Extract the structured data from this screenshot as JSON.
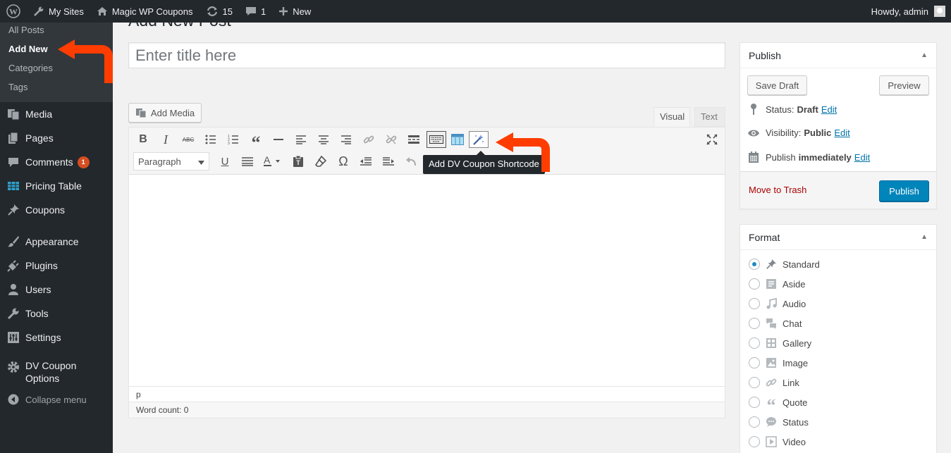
{
  "adminbar": {
    "my_sites": "My Sites",
    "site_name": "Magic WP Coupons",
    "updates": "15",
    "comments": "1",
    "new": "New",
    "howdy": "Howdy, admin"
  },
  "sidebar": {
    "submenu": [
      "All Posts",
      "Add New",
      "Categories",
      "Tags"
    ],
    "items": [
      {
        "label": "Media",
        "icon": "media-icon"
      },
      {
        "label": "Pages",
        "icon": "pages-icon"
      },
      {
        "label": "Comments",
        "icon": "comments-icon",
        "badge": "1"
      },
      {
        "label": "Pricing Table",
        "icon": "table-icon"
      },
      {
        "label": "Coupons",
        "icon": "pin-icon"
      },
      {
        "label": "Appearance",
        "icon": "brush-icon"
      },
      {
        "label": "Plugins",
        "icon": "plug-icon"
      },
      {
        "label": "Users",
        "icon": "users-icon"
      },
      {
        "label": "Tools",
        "icon": "wrench-icon"
      },
      {
        "label": "Settings",
        "icon": "settings-icon"
      },
      {
        "label_line1": "DV Coupon",
        "label_line2": "Options",
        "icon": "gear-icon"
      }
    ],
    "collapse": "Collapse menu"
  },
  "main": {
    "page_title": "Add New Post",
    "title_placeholder": "Enter title here",
    "add_media": "Add Media",
    "tab_visual": "Visual",
    "tab_text": "Text",
    "format_select": "Paragraph",
    "tooltip": "Add DV Coupon Shortcode",
    "path": "p",
    "word_count": "Word count: 0"
  },
  "publish": {
    "title": "Publish",
    "save_draft": "Save Draft",
    "preview": "Preview",
    "status_label": "Status:",
    "status_value": "Draft",
    "visibility_label": "Visibility:",
    "visibility_value": "Public",
    "publish_label": "Publish",
    "publish_value": "immediately",
    "edit": "Edit",
    "move_to_trash": "Move to Trash",
    "publish_button": "Publish"
  },
  "format": {
    "title": "Format",
    "selected": "Standard",
    "options": [
      "Standard",
      "Aside",
      "Audio",
      "Chat",
      "Gallery",
      "Image",
      "Link",
      "Quote",
      "Status",
      "Video"
    ]
  },
  "colors": {
    "admin_dark": "#23282d",
    "accent": "#0085ba",
    "annotation_arrow": "#ff3d00"
  }
}
